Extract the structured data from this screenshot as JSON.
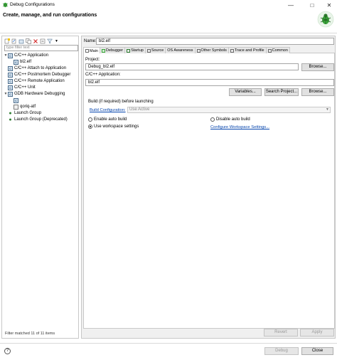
{
  "window": {
    "title": "Debug Configurations",
    "minimize_icon": "minimize-icon",
    "maximize_icon": "maximize-icon",
    "close_icon": "close-icon"
  },
  "header": {
    "title": "Create, manage, and run configurations"
  },
  "left": {
    "filter_placeholder": "type filter text",
    "tree": [
      {
        "label": "C/C++ Application",
        "level": 0,
        "expanded": true
      },
      {
        "label": "bl2.elf",
        "level": 1
      },
      {
        "label": "C/C++ Attach to Application",
        "level": 0
      },
      {
        "label": "C/C++ Postmortem Debugger",
        "level": 0
      },
      {
        "label": "C/C++ Remote Application",
        "level": 0
      },
      {
        "label": "C/C++ Unit",
        "level": 0
      },
      {
        "label": "GDB Hardware Debugging",
        "level": 0,
        "expanded": true
      },
      {
        "label": "",
        "level": 1
      },
      {
        "label": "qoriq-atf",
        "level": 1
      },
      {
        "label": "Launch Group",
        "level": 0
      },
      {
        "label": "Launch Group (Deprecated)",
        "level": 0
      }
    ],
    "status": "Filter matched 11 of 11 items"
  },
  "right": {
    "name_label": "Name:",
    "name_value": "bl2.elf",
    "tabs": [
      "Main",
      "Debugger",
      "Startup",
      "Source",
      "OS Awareness",
      "Other Symbols",
      "Trace and Profile",
      "Common"
    ],
    "project_label": "Project:",
    "project_value": "Debug_bl2.elf",
    "browse_label": "Browse...",
    "app_label": "C/C++ Application:",
    "app_value": "bl2.elf",
    "variables_label": "Variables...",
    "search_project_label": "Search Project...",
    "build_label": "Build (if required) before launching",
    "build_config_link": "Build Configuration:",
    "build_config_value": "Use Active",
    "enable_auto_build": "Enable auto build",
    "disable_auto_build": "Disable auto build",
    "use_workspace": "Use workspace settings",
    "configure_workspace": "Configure Workspace Settings...",
    "revert_label": "Revert",
    "apply_label": "Apply"
  },
  "bottom": {
    "debug_label": "Debug",
    "close_label": "Close",
    "help_label": "?"
  },
  "colors": {
    "link": "#0645ad",
    "bug_green": "#3aa63a"
  }
}
